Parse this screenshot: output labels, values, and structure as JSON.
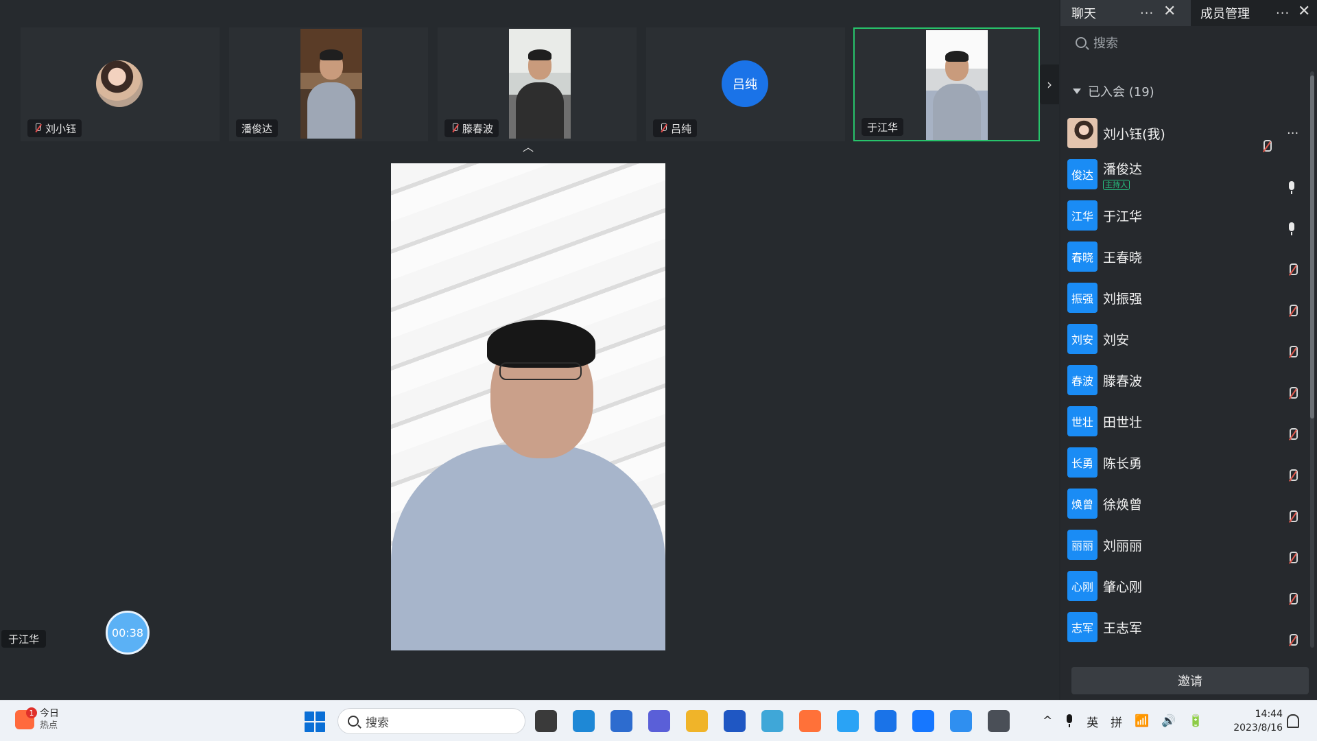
{
  "thumbnails": [
    {
      "name": "刘小钰",
      "muted": true,
      "kind": "avatar"
    },
    {
      "name": "潘俊达",
      "muted": false,
      "kind": "video"
    },
    {
      "name": "滕春波",
      "muted": true,
      "kind": "video"
    },
    {
      "name": "吕纯",
      "muted": true,
      "kind": "initial",
      "initial": "吕纯"
    },
    {
      "name": "于江华",
      "muted": false,
      "kind": "video",
      "active": true
    }
  ],
  "main_video": {
    "speaker": "于江华"
  },
  "timer": "00:38",
  "panel": {
    "tab_chat": "聊天",
    "tab_members": "成员管理",
    "more": "···",
    "search_placeholder": "搜索",
    "group_label": "已入会 (19)",
    "invite": "邀请"
  },
  "members": [
    {
      "avatar": "",
      "name": "刘小钰(我)",
      "mic": "muted",
      "photo": true,
      "more": "···"
    },
    {
      "avatar": "俊达",
      "name": "潘俊达",
      "role": "主持人",
      "mic": "on"
    },
    {
      "avatar": "江华",
      "name": "于江华",
      "mic": "on"
    },
    {
      "avatar": "春晓",
      "name": "王春晓",
      "mic": "muted"
    },
    {
      "avatar": "振强",
      "name": "刘振强",
      "mic": "muted"
    },
    {
      "avatar": "刘安",
      "name": "刘安",
      "mic": "muted"
    },
    {
      "avatar": "春波",
      "name": "滕春波",
      "mic": "muted"
    },
    {
      "avatar": "世壮",
      "name": "田世壮",
      "mic": "muted"
    },
    {
      "avatar": "长勇",
      "name": "陈长勇",
      "mic": "muted"
    },
    {
      "avatar": "焕曾",
      "name": "徐焕曾",
      "mic": "muted"
    },
    {
      "avatar": "丽丽",
      "name": "刘丽丽",
      "mic": "muted"
    },
    {
      "avatar": "心刚",
      "name": "肇心刚",
      "mic": "muted"
    },
    {
      "avatar": "志军",
      "name": "王志军",
      "mic": "muted"
    }
  ],
  "taskbar": {
    "widget_title": "今日",
    "widget_sub": "热点",
    "widget_badge": "1",
    "search_label": "搜索",
    "tray_lang": "英",
    "tray_ime": "拼",
    "time": "14:44",
    "date": "2023/8/16",
    "apps": [
      "task-view-icon",
      "edge-icon",
      "store-icon",
      "app-icon",
      "explorer-icon",
      "app-icon",
      "app-icon",
      "firefox-icon",
      "app-icon",
      "app-icon",
      "meeting-icon",
      "app-icon",
      "settings-icon"
    ],
    "colors": {
      "accent": "#1a8cf5",
      "active_border": "#27c46b"
    }
  }
}
